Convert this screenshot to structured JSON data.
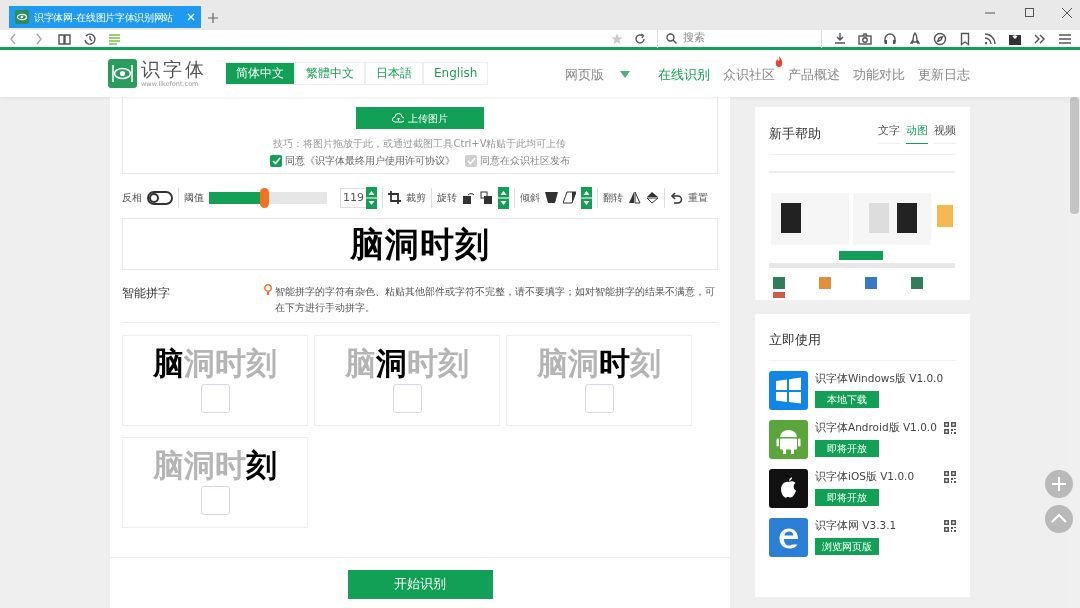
{
  "browser": {
    "tab_title": "识字体网-在线图片字体识别网站",
    "search_placeholder": "搜索"
  },
  "site": {
    "logo_text": "识字体",
    "logo_url": "www.likefont.com",
    "languages": [
      {
        "label": "简体中文",
        "selected": true
      },
      {
        "label": "繁體中文",
        "selected": false
      },
      {
        "label": "日本語",
        "selected": false
      },
      {
        "label": "English",
        "selected": false
      }
    ],
    "nav": [
      {
        "label": "网页版",
        "kind": "dropdown",
        "selected": false,
        "hot": false
      },
      {
        "label": "在线识别",
        "kind": "link",
        "selected": true,
        "hot": false
      },
      {
        "label": "众识社区",
        "kind": "link",
        "selected": false,
        "hot": true
      },
      {
        "label": "产品概述",
        "kind": "link",
        "selected": false,
        "hot": false
      },
      {
        "label": "功能对比",
        "kind": "link",
        "selected": false,
        "hot": false
      },
      {
        "label": "更新日志",
        "kind": "link",
        "selected": false,
        "hot": false
      }
    ]
  },
  "upload": {
    "button": "上传图片",
    "tip": "技巧：将图片拖放于此，或通过截图工具Ctrl+V粘贴于此均可上传",
    "agreements": [
      {
        "label": "同意《识字体最终用户使用许可协议》",
        "checked": true,
        "disabled": false
      },
      {
        "label": "同意在众识社区发布",
        "checked": true,
        "disabled": true
      }
    ]
  },
  "toolbar": {
    "invert_label": "反相",
    "invert_on": false,
    "threshold_label": "阈值",
    "level": 0.47,
    "threshold_value": "119",
    "crop": "裁剪",
    "rotate": "旋转",
    "skew": "倾斜",
    "flip": "翻转",
    "reset": "重置"
  },
  "preview": "脑洞时刻",
  "smart": {
    "title": "智能拼字",
    "hint": "智能拼字的字符有杂色、粘贴其他部件或字符不完整，请不要填字；如对智能拼字的结果不满意，可在下方进行手动拼字。"
  },
  "cards": [
    {
      "checked": false,
      "glyphs": [
        {
          "char": "脑",
          "selected": true
        },
        {
          "char": "洞",
          "selected": false
        },
        {
          "char": "时",
          "selected": false
        },
        {
          "char": "刻",
          "selected": false
        }
      ]
    },
    {
      "checked": false,
      "glyphs": [
        {
          "char": "脑",
          "selected": false
        },
        {
          "char": "洞",
          "selected": true
        },
        {
          "char": "时",
          "selected": false
        },
        {
          "char": "刻",
          "selected": false
        }
      ]
    },
    {
      "checked": false,
      "glyphs": [
        {
          "char": "脑",
          "selected": false
        },
        {
          "char": "洞",
          "selected": false
        },
        {
          "char": "时",
          "selected": true
        },
        {
          "char": "刻",
          "selected": false
        }
      ]
    },
    {
      "checked": false,
      "glyphs": [
        {
          "char": "脑",
          "selected": false
        },
        {
          "char": "洞",
          "selected": false
        },
        {
          "char": "时",
          "selected": false
        },
        {
          "char": "刻",
          "selected": true
        }
      ]
    }
  ],
  "start_button": "开始识别",
  "help": {
    "title": "新手帮助",
    "tabs": [
      {
        "label": "文字",
        "selected": false
      },
      {
        "label": "动图",
        "selected": true
      },
      {
        "label": "视频",
        "selected": false
      }
    ]
  },
  "use": {
    "title": "立即使用",
    "apps": [
      {
        "kind": "windows",
        "name": "识字体Windows版 V1.0.0",
        "button": "本地下载",
        "qr": false
      },
      {
        "kind": "android",
        "name": "识字体Android版 V1.0.0",
        "button": "即将开放",
        "qr": true
      },
      {
        "kind": "ios",
        "name": "识字体iOS版 V1.0.0",
        "button": "即将开放",
        "qr": true
      },
      {
        "kind": "web",
        "name": "识字体网 V3.3.1",
        "button": "浏览网页版",
        "qr": true
      }
    ]
  }
}
